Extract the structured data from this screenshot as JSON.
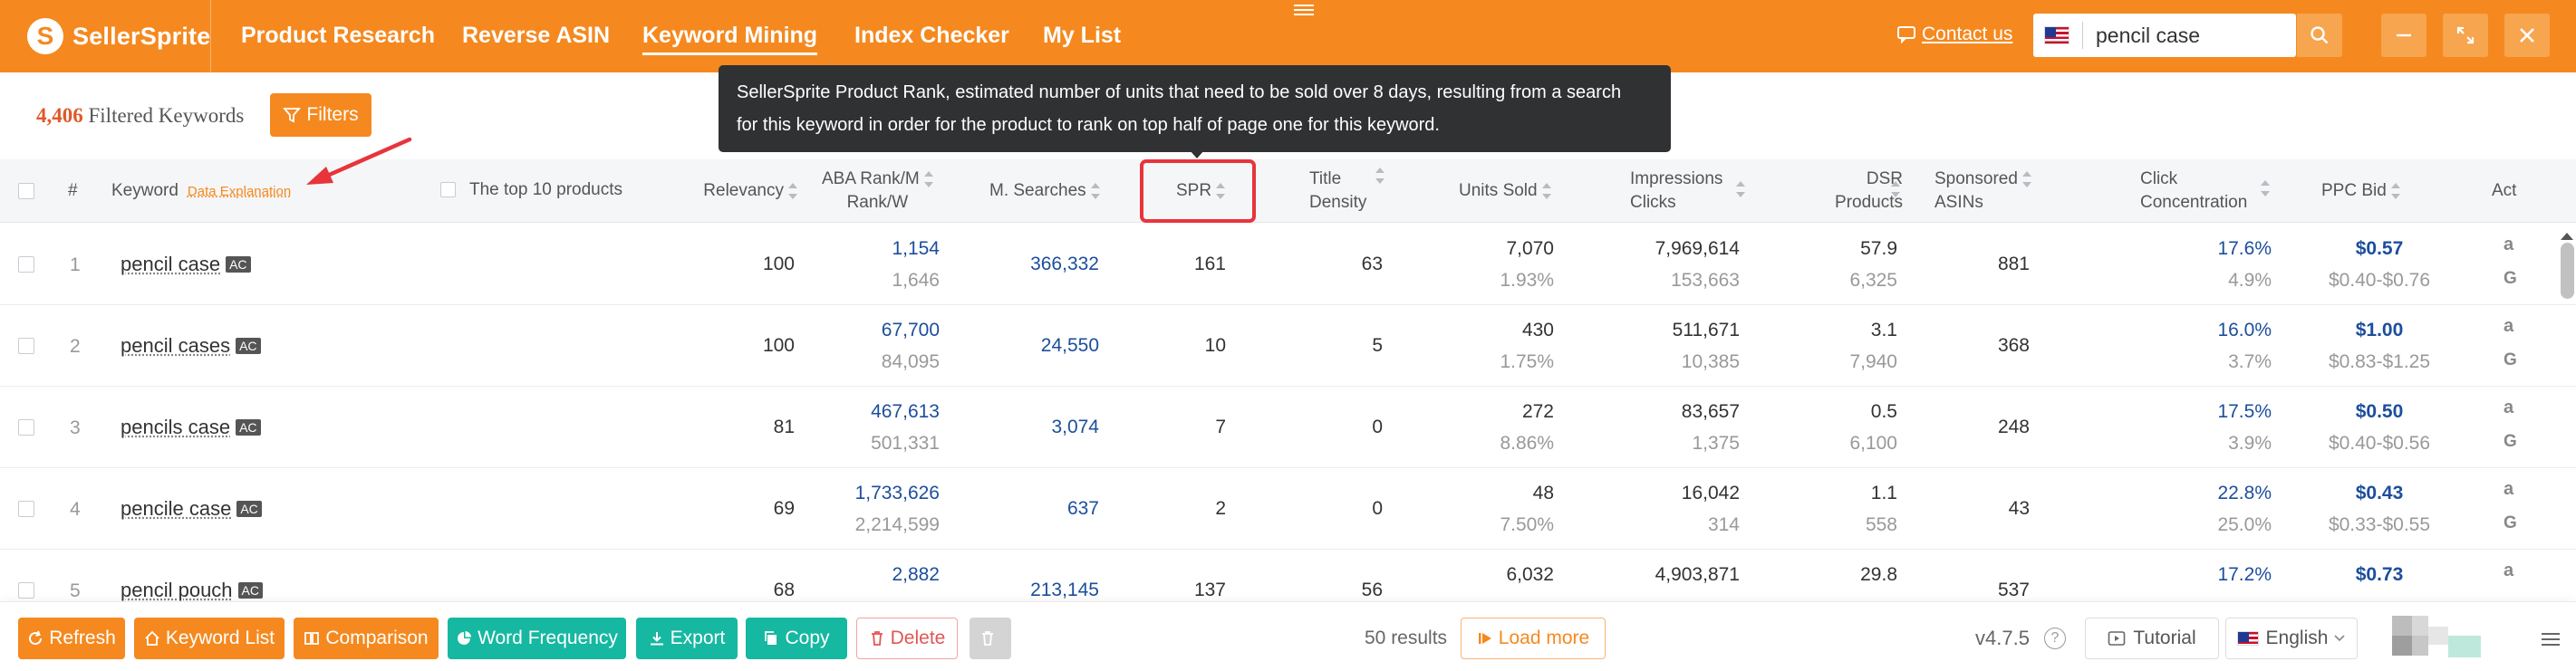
{
  "app": {
    "name": "SellerSprite"
  },
  "nav": [
    {
      "label": "Product Research",
      "active": false
    },
    {
      "label": "Reverse ASIN",
      "active": false
    },
    {
      "label": "Keyword Mining",
      "active": true
    },
    {
      "label": "Index Checker",
      "active": false
    },
    {
      "label": "My List",
      "active": false
    }
  ],
  "header": {
    "contact_label": "Contact us",
    "search_value": "pencil case",
    "marketplace_flag": "us-flag-icon"
  },
  "summary": {
    "count": "4,406",
    "label": "Filtered Keywords",
    "filters_label": "Filters"
  },
  "tooltip": {
    "line1": "SellerSprite Product Rank, estimated number of units that need to be sold over 8 days, resulting from a search",
    "line2": "for this keyword in order for the product to rank on top half of page one for this keyword."
  },
  "columns": {
    "index": "#",
    "keyword": "Keyword",
    "data_explanation": "Data Explanation",
    "top10": "The top 10 products",
    "relevancy": "Relevancy",
    "aba_1": "ABA Rank/M",
    "aba_2": "Rank/W",
    "msearches": "M. Searches",
    "spr": "SPR",
    "title_1": "Title",
    "title_2": "Density",
    "units": "Units Sold",
    "imp_1": "Impressions",
    "imp_2": "Clicks",
    "dsr_1": "DSR",
    "dsr_2": "Products",
    "sp_1": "Sponsored",
    "sp_2": "ASINs",
    "click_1": "Click",
    "click_2": "Concentration",
    "ppc": "PPC Bid",
    "act": "Act"
  },
  "rows": [
    {
      "idx": "1",
      "keyword": "pencil case",
      "badge": "AC",
      "relevancy": "100",
      "aba_m": "1,154",
      "aba_w": "1,646",
      "msearches": "366,332",
      "spr": "161",
      "title_density": "63",
      "units": "7,070",
      "units_pct": "1.93%",
      "impressions": "7,969,614",
      "clicks": "153,663",
      "dsr": "57.9",
      "products": "6,325",
      "sponsored": "881",
      "click_conc": "17.6%",
      "click_sub": "4.9%",
      "ppc": "$0.57",
      "ppc_range": "$0.40-$0.76"
    },
    {
      "idx": "2",
      "keyword": "pencil cases",
      "badge": "AC",
      "relevancy": "100",
      "aba_m": "67,700",
      "aba_w": "84,095",
      "msearches": "24,550",
      "spr": "10",
      "title_density": "5",
      "units": "430",
      "units_pct": "1.75%",
      "impressions": "511,671",
      "clicks": "10,385",
      "dsr": "3.1",
      "products": "7,940",
      "sponsored": "368",
      "click_conc": "16.0%",
      "click_sub": "3.7%",
      "ppc": "$1.00",
      "ppc_range": "$0.83-$1.25"
    },
    {
      "idx": "3",
      "keyword": "pencils case",
      "badge": "AC",
      "relevancy": "81",
      "aba_m": "467,613",
      "aba_w": "501,331",
      "msearches": "3,074",
      "spr": "7",
      "title_density": "0",
      "units": "272",
      "units_pct": "8.86%",
      "impressions": "83,657",
      "clicks": "1,375",
      "dsr": "0.5",
      "products": "6,100",
      "sponsored": "248",
      "click_conc": "17.5%",
      "click_sub": "3.9%",
      "ppc": "$0.50",
      "ppc_range": "$0.40-$0.56"
    },
    {
      "idx": "4",
      "keyword": "pencile case",
      "badge": "AC",
      "relevancy": "69",
      "aba_m": "1,733,626",
      "aba_w": "2,214,599",
      "msearches": "637",
      "spr": "2",
      "title_density": "0",
      "units": "48",
      "units_pct": "7.50%",
      "impressions": "16,042",
      "clicks": "314",
      "dsr": "1.1",
      "products": "558",
      "sponsored": "43",
      "click_conc": "22.8%",
      "click_sub": "25.0%",
      "ppc": "$0.43",
      "ppc_range": "$0.33-$0.55"
    },
    {
      "idx": "5",
      "keyword": "pencil pouch",
      "badge": "AC",
      "relevancy": "68",
      "aba_m": "2,882",
      "aba_w": "",
      "msearches": "213,145",
      "spr": "137",
      "title_density": "56",
      "units": "6,032",
      "units_pct": "",
      "impressions": "4,903,871",
      "clicks": "",
      "dsr": "29.8",
      "products": "",
      "sponsored": "537",
      "click_conc": "17.2%",
      "click_sub": "",
      "ppc": "$0.73",
      "ppc_range": ""
    }
  ],
  "bottom": {
    "refresh": "Refresh",
    "keyword_list": "Keyword List",
    "comparison": "Comparison",
    "word_frequency": "Word Frequency",
    "export": "Export",
    "copy": "Copy",
    "delete": "Delete",
    "results": "50 results",
    "load_more": "Load more",
    "version": "v4.7.5",
    "help": "?",
    "tutorial": "Tutorial",
    "language": "English"
  },
  "colors": {
    "brand_orange": "#f5891f",
    "teal": "#16b8a1",
    "link_blue": "#1c4e9c",
    "highlight_red": "#e8343b"
  }
}
